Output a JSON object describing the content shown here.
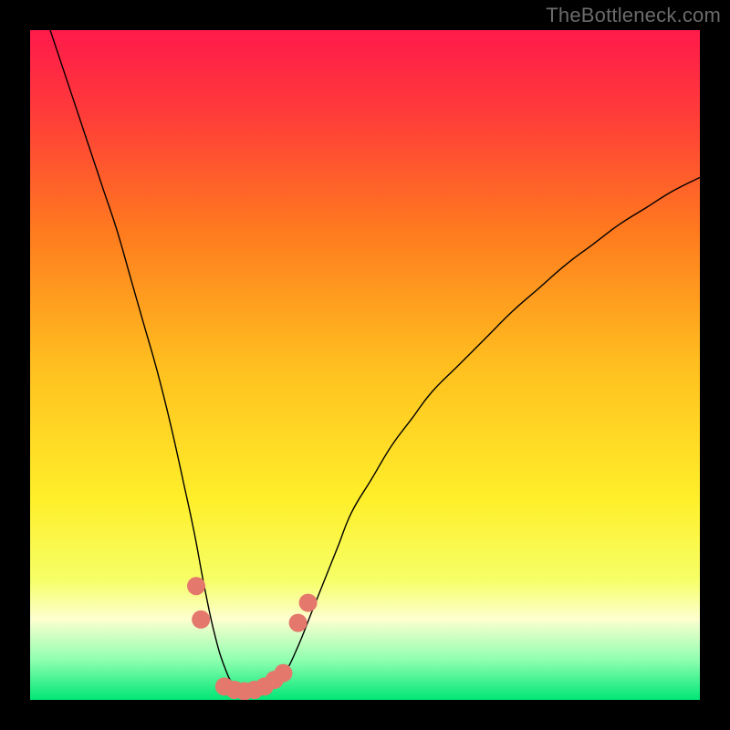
{
  "watermark": "TheBottleneck.com",
  "chart_data": {
    "type": "line",
    "title": "",
    "xlabel": "",
    "ylabel": "",
    "xlim": [
      0,
      100
    ],
    "ylim": [
      0,
      100
    ],
    "background": {
      "type": "vertical-gradient",
      "stops": [
        {
          "offset": 0.0,
          "color": "#ff1a4b"
        },
        {
          "offset": 0.12,
          "color": "#ff3a3a"
        },
        {
          "offset": 0.3,
          "color": "#ff7a1f"
        },
        {
          "offset": 0.5,
          "color": "#ffbf1f"
        },
        {
          "offset": 0.7,
          "color": "#ffef2a"
        },
        {
          "offset": 0.82,
          "color": "#f6ff66"
        },
        {
          "offset": 0.88,
          "color": "#fdffd0"
        },
        {
          "offset": 0.94,
          "color": "#8fffb0"
        },
        {
          "offset": 1.0,
          "color": "#00e676"
        }
      ]
    },
    "series": [
      {
        "name": "curve",
        "color": "#000000",
        "stroke_width": 1.4,
        "x": [
          3,
          5,
          7,
          9,
          11,
          13,
          15,
          17,
          19,
          21,
          23,
          24.5,
          26,
          27.5,
          29,
          30.5,
          32,
          34,
          36,
          38,
          40,
          42,
          44,
          46,
          48,
          51,
          54,
          57,
          60,
          64,
          68,
          72,
          76,
          80,
          84,
          88,
          92,
          96,
          100
        ],
        "y": [
          100,
          94,
          88,
          82,
          76,
          70,
          63,
          56,
          49,
          41,
          32,
          25,
          17,
          10,
          5,
          2,
          1,
          1,
          2,
          4,
          8,
          13,
          18,
          23,
          28,
          33,
          38,
          42,
          46,
          50,
          54,
          58,
          61.5,
          65,
          68,
          71,
          73.5,
          76,
          78
        ]
      }
    ],
    "markers": {
      "name": "marker-dots",
      "color": "#e4786c",
      "radius": 10,
      "points": [
        {
          "x": 24.8,
          "y": 17
        },
        {
          "x": 25.5,
          "y": 12
        },
        {
          "x": 29.0,
          "y": 2.0
        },
        {
          "x": 30.5,
          "y": 1.5
        },
        {
          "x": 32.0,
          "y": 1.3
        },
        {
          "x": 33.5,
          "y": 1.5
        },
        {
          "x": 35.0,
          "y": 2.0
        },
        {
          "x": 36.5,
          "y": 3.0
        },
        {
          "x": 37.8,
          "y": 4.0
        },
        {
          "x": 40.0,
          "y": 11.5
        },
        {
          "x": 41.5,
          "y": 14.5
        }
      ]
    }
  },
  "colors": {
    "frame": "#000000",
    "watermark": "#6b6b6b"
  }
}
